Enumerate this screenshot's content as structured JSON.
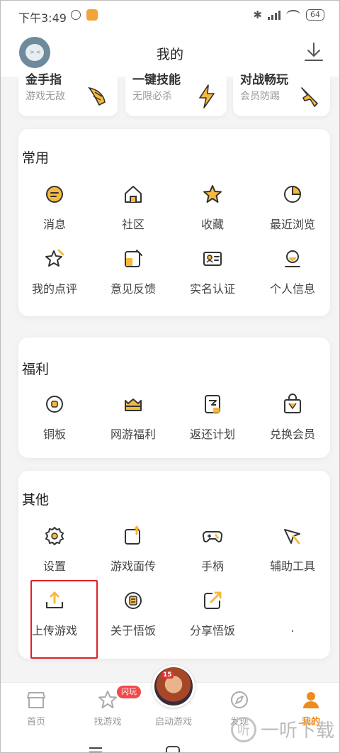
{
  "status_bar": {
    "time": "下午3:49",
    "battery": "64"
  },
  "header": {
    "title": "我的"
  },
  "features": [
    {
      "title": "金手指",
      "subtitle": "游戏无敌",
      "icon": "wing-icon"
    },
    {
      "title": "一键技能",
      "subtitle": "无限必杀",
      "icon": "lightning-icon"
    },
    {
      "title": "对战畅玩",
      "subtitle": "会员防踢",
      "icon": "plane-icon"
    }
  ],
  "sections": {
    "common": {
      "title": "常用",
      "items": [
        {
          "label": "消息",
          "icon": "message-icon"
        },
        {
          "label": "社区",
          "icon": "community-icon"
        },
        {
          "label": "收藏",
          "icon": "favorite-icon"
        },
        {
          "label": "最近浏览",
          "icon": "history-icon"
        },
        {
          "label": "我的点评",
          "icon": "review-icon"
        },
        {
          "label": "意见反馈",
          "icon": "feedback-icon"
        },
        {
          "label": "实名认证",
          "icon": "id-card-icon"
        },
        {
          "label": "个人信息",
          "icon": "profile-icon"
        }
      ]
    },
    "welfare": {
      "title": "福利",
      "items": [
        {
          "label": "铜板",
          "icon": "coin-icon"
        },
        {
          "label": "网游福利",
          "icon": "gift-box-icon"
        },
        {
          "label": "返还计划",
          "icon": "rebate-icon"
        },
        {
          "label": "兑换会员",
          "icon": "shopping-bag-icon"
        }
      ]
    },
    "other": {
      "title": "其他",
      "items": [
        {
          "label": "设置",
          "icon": "gear-icon"
        },
        {
          "label": "游戏面传",
          "icon": "transfer-icon"
        },
        {
          "label": "手柄",
          "icon": "gamepad-icon"
        },
        {
          "label": "辅助工具",
          "icon": "tool-icon"
        },
        {
          "label": "上传游戏",
          "icon": "upload-icon"
        },
        {
          "label": "关于悟饭",
          "icon": "about-icon"
        },
        {
          "label": "分享悟饭",
          "icon": "share-icon"
        },
        {
          "label": ".",
          "icon": ""
        }
      ]
    }
  },
  "tabbar": {
    "items": [
      {
        "label": "首页",
        "icon": "home-icon",
        "active": false
      },
      {
        "label": "找游戏",
        "icon": "star-icon",
        "active": false,
        "badge": "闪玩"
      },
      {
        "label": "启动游戏",
        "icon": "game-avatar",
        "active": false
      },
      {
        "label": "发现",
        "icon": "compass-icon",
        "active": false
      },
      {
        "label": "我的",
        "icon": "user-icon",
        "active": true
      }
    ]
  },
  "game_avatar_level": "15",
  "watermark": "一听下载",
  "watermark_logo": "听",
  "colors": {
    "accent": "#f08a1c",
    "badge": "#f04a4a",
    "highlight": "#e0202a"
  }
}
